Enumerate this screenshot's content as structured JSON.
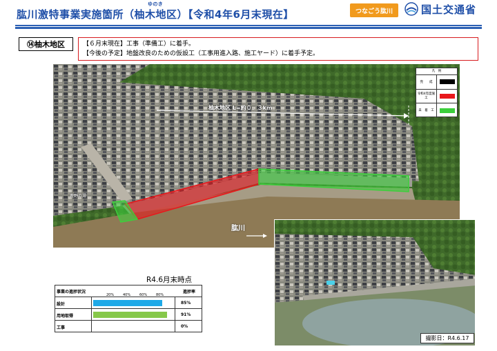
{
  "header": {
    "title": "肱川激特事業実施箇所（柚木地区）【令和4年6月末現在】",
    "ruby": "ゆのき",
    "logo_text": "つなごう肱川",
    "ministry": "国土交通省"
  },
  "district_label": "⑭柚木地区",
  "status_lines": [
    "【６月末現在】工事（準備工）に着手。",
    "【今後の予定】地盤改良のための仮設工（工事用進入路、施工ヤード）に着手予定。"
  ],
  "photo": {
    "distance_label": "柚木地区 L=約０．３km",
    "river_label": "肱川",
    "hotel_label": "鹿野の湯"
  },
  "legend": {
    "title": "凡　例",
    "items": [
      {
        "label": "完　　成",
        "color": "#000000"
      },
      {
        "label": "令和4年度施工",
        "color": "#e8181c"
      },
      {
        "label": "未　着　工",
        "color": "#3ccf3c"
      }
    ]
  },
  "inset_caption": "撮影日：R4.6.17",
  "progress": {
    "caption": "R4.6月末時点",
    "column_title": "事業の進捗状況",
    "rate_title": "進捗率",
    "ticks": [
      "20%",
      "40%",
      "60%",
      "80%"
    ],
    "rows": [
      {
        "label": "設計",
        "percent": 85,
        "display": "85%",
        "color": "#1ea9e8"
      },
      {
        "label": "用地取得",
        "percent": 91,
        "display": "91%",
        "color": "#86c84a"
      },
      {
        "label": "工事",
        "percent": 0,
        "display": "0%",
        "color": "#86c84a"
      }
    ]
  }
}
